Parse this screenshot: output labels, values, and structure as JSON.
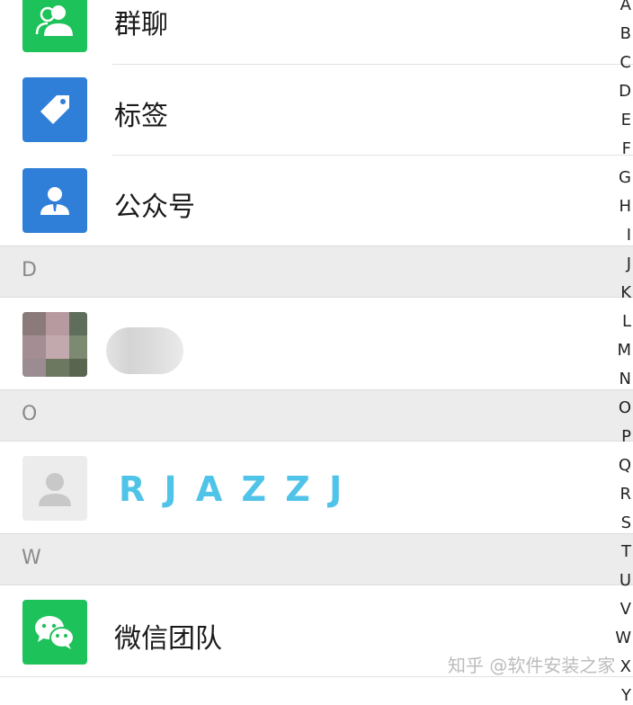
{
  "contacts_top": [
    {
      "name": "群聊",
      "icon": "group-icon",
      "color": "#1ec25a"
    },
    {
      "name": "标签",
      "icon": "tag-icon",
      "color": "#2f7fd9"
    },
    {
      "name": "公众号",
      "icon": "official-account-icon",
      "color": "#2f7fd9"
    }
  ],
  "sections": [
    {
      "letter": "D"
    },
    {
      "letter": "O"
    },
    {
      "letter": "W"
    }
  ],
  "contact_o": {
    "name": "R J A Z Z J",
    "icon": "default-avatar-icon"
  },
  "contact_w": {
    "name": "微信团队",
    "icon": "wechat-icon",
    "color": "#1ec25a"
  },
  "index_letters": [
    "A",
    "B",
    "C",
    "D",
    "E",
    "F",
    "G",
    "H",
    "I",
    "J",
    "K",
    "L",
    "M",
    "N",
    "O",
    "P",
    "Q",
    "R",
    "S",
    "T",
    "U",
    "V",
    "W",
    "X",
    "Y"
  ],
  "watermark": "知乎 @软件安装之家",
  "colors": {
    "accent_green": "#1ec25a",
    "accent_blue": "#2f7fd9",
    "section_bg": "#ececec"
  }
}
